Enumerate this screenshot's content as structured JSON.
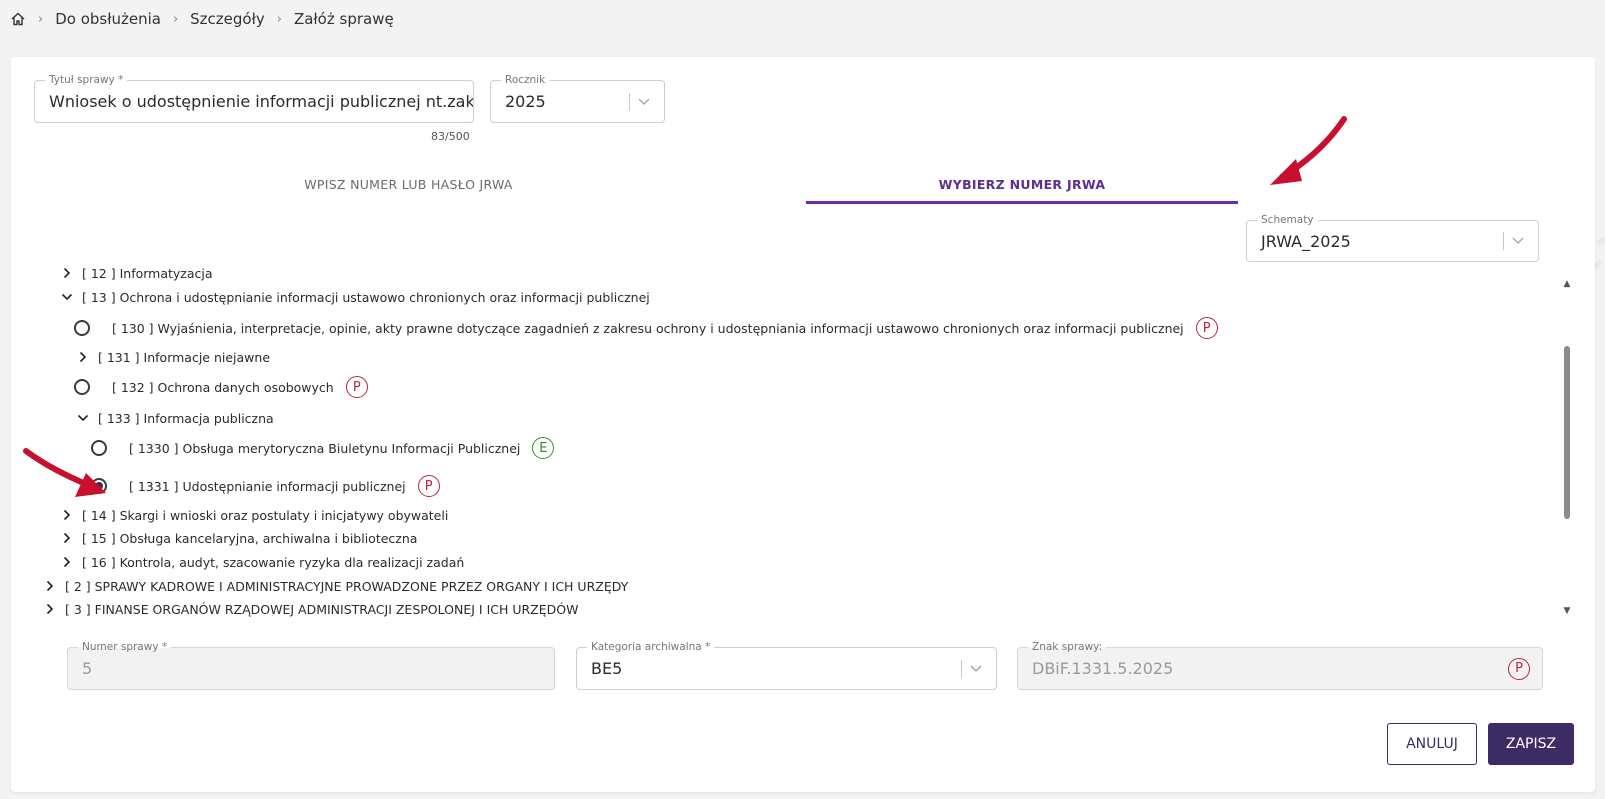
{
  "breadcrumb": {
    "items": [
      "Do obsłużenia",
      "Szczegóły",
      "Załóż sprawę"
    ]
  },
  "form": {
    "title": {
      "label": "Tytuł sprawy *",
      "value": "Wniosek o udostępnienie informacji publicznej nt.zakupów",
      "counter": "83/500"
    },
    "year": {
      "label": "Rocznik",
      "value": "2025"
    }
  },
  "tabs": {
    "enter": "WPISZ NUMER LUB HASŁO JRWA",
    "choose": "WYBIERZ NUMER JRWA"
  },
  "schema": {
    "label": "Schematy",
    "value": "JRWA_2025"
  },
  "tree": {
    "rows": [
      {
        "label": "[ 12 ] Informatyzacja"
      },
      {
        "label": "[ 13 ] Ochrona i udostępnianie informacji ustawowo chronionych oraz informacji publicznej"
      },
      {
        "label": "[ 130 ] Wyjaśnienia, interpretacje, opinie, akty prawne dotyczące zagadnień z zakresu ochrony i udostępniania informacji ustawowo chronionych oraz informacji publicznej",
        "badge": "P"
      },
      {
        "label": "[ 131 ] Informacje niejawne"
      },
      {
        "label": "[ 132 ] Ochrona danych osobowych",
        "badge": "P"
      },
      {
        "label": "[ 133 ] Informacja publiczna"
      },
      {
        "label": "[ 1330 ] Obsługa merytoryczna Biuletynu Informacji Publicznej",
        "badge": "E"
      },
      {
        "label": "[ 1331 ] Udostępnianie informacji publicznej",
        "badge": "P"
      },
      {
        "label": "[ 14 ] Skargi i wnioski oraz postulaty i inicjatywy obywateli"
      },
      {
        "label": "[ 15 ] Obsługa kancelaryjna, archiwalna i biblioteczna"
      },
      {
        "label": "[ 16 ] Kontrola, audyt, szacowanie ryzyka dla realizacji zadań"
      },
      {
        "label": "[ 2 ] SPRAWY KADROWE I ADMINISTRACYJNE PROWADZONE PRZEZ ORGANY I ICH URZĘDY"
      },
      {
        "label": "[ 3 ] FINANSE ORGANÓW RZĄDOWEJ ADMINISTRACJI ZESPOLONEJ I ICH URZĘDÓW"
      }
    ]
  },
  "case": {
    "number": {
      "label": "Numer sprawy *",
      "value": "5"
    },
    "category": {
      "label": "Kategoria archiwalna *",
      "value": "BE5"
    },
    "sign": {
      "label": "Znak sprawy:",
      "value": "DBiF.1331.5.2025",
      "badge": "P"
    }
  },
  "buttons": {
    "cancel": "ANULUJ",
    "save": "ZAPISZ"
  },
  "watermark": {
    "text1": "NASK – Państwowy Instytut Badawczy",
    "text2": "EZD RP"
  },
  "colors": {
    "accent": "#6a2fa5",
    "primary_button": "#3d2c63",
    "badge_red": "#b8263f",
    "badge_green": "#3a8a2c",
    "annotation_arrow": "#c8102e"
  }
}
